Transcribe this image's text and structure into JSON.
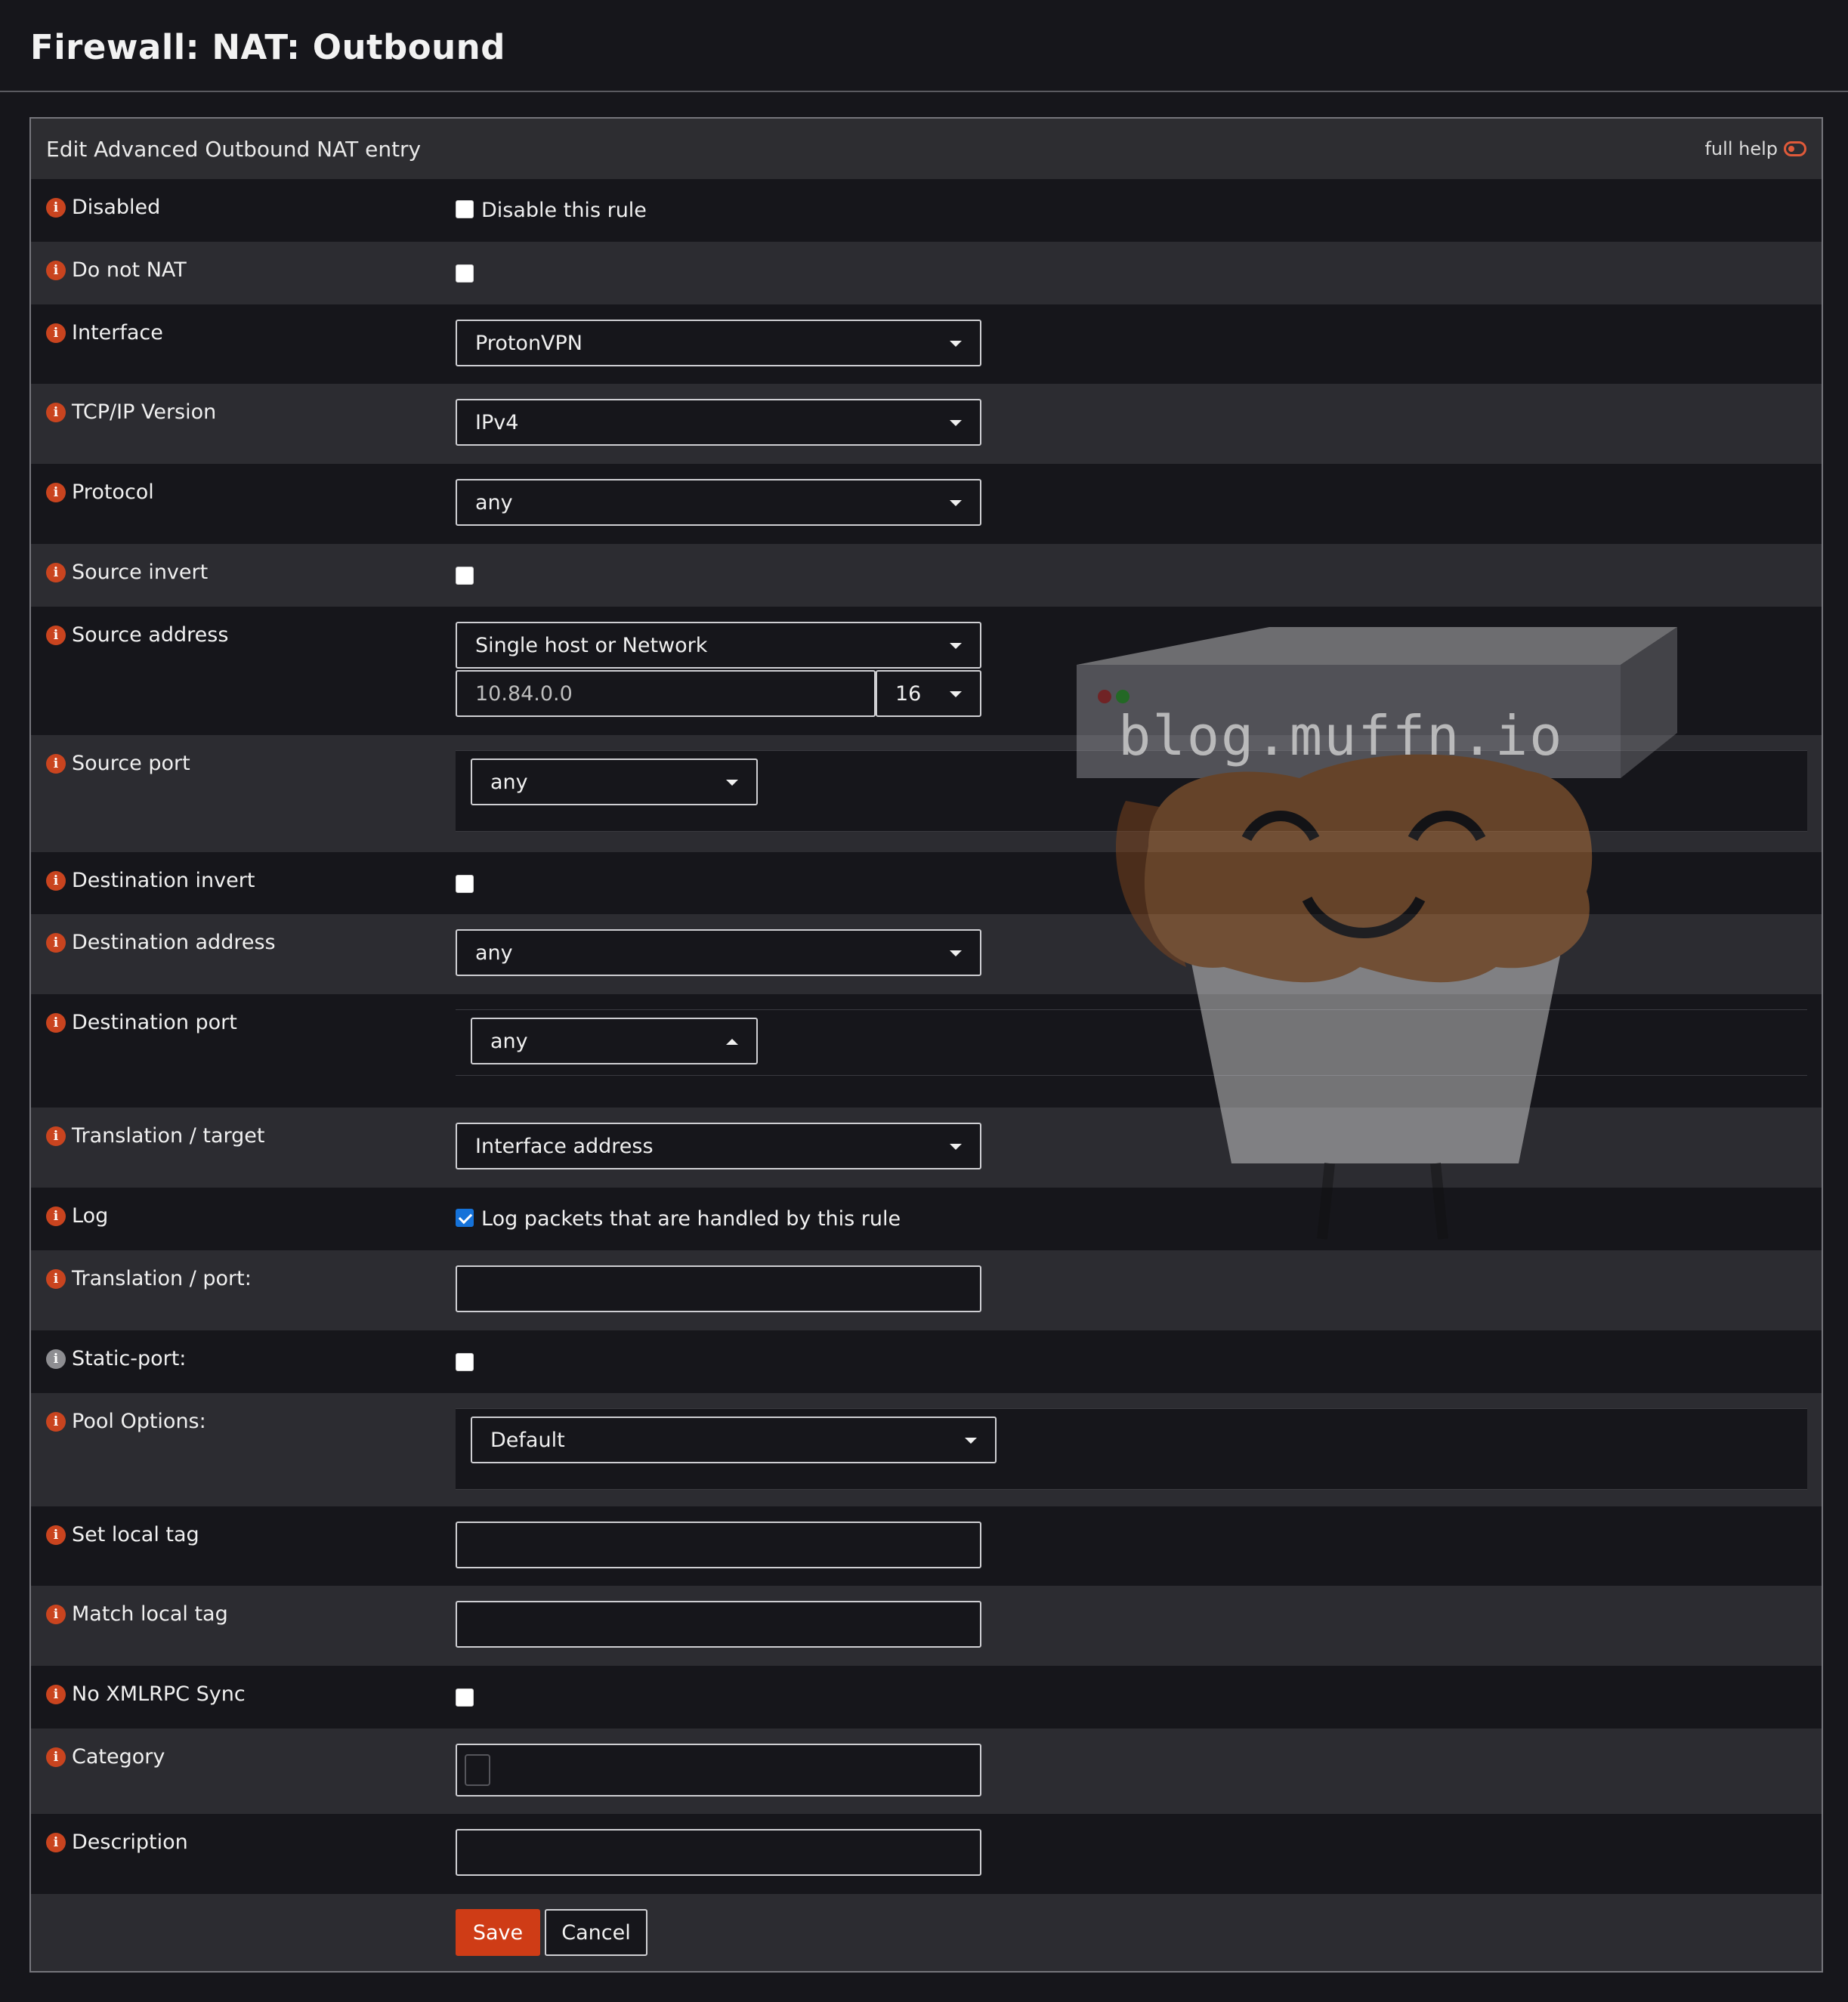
{
  "page": {
    "title": "Firewall: NAT: Outbound"
  },
  "panel": {
    "title": "Edit Advanced Outbound NAT entry",
    "full_help": "full help"
  },
  "fields": {
    "disabled": {
      "label": "Disabled",
      "checkbox_label": "Disable this rule",
      "checked": false
    },
    "do_not_nat": {
      "label": "Do not NAT",
      "checked": false
    },
    "interface": {
      "label": "Interface",
      "value": "ProtonVPN"
    },
    "tcpip_version": {
      "label": "TCP/IP Version",
      "value": "IPv4"
    },
    "protocol": {
      "label": "Protocol",
      "value": "any"
    },
    "source_invert": {
      "label": "Source invert",
      "checked": false
    },
    "source_address": {
      "label": "Source address",
      "type_value": "Single host or Network",
      "address": "10.84.0.0",
      "mask": "16"
    },
    "source_port": {
      "label": "Source port",
      "value": "any"
    },
    "destination_invert": {
      "label": "Destination invert",
      "checked": false
    },
    "destination_address": {
      "label": "Destination address",
      "value": "any"
    },
    "destination_port": {
      "label": "Destination port",
      "value": "any"
    },
    "translation_target": {
      "label": "Translation / target",
      "value": "Interface address"
    },
    "log": {
      "label": "Log",
      "checkbox_label": "Log packets that are handled by this rule",
      "checked": true
    },
    "translation_port": {
      "label": "Translation / port:",
      "value": ""
    },
    "static_port": {
      "label": "Static-port:",
      "checked": false
    },
    "pool_options": {
      "label": "Pool Options:",
      "value": "Default"
    },
    "set_local_tag": {
      "label": "Set local tag",
      "value": ""
    },
    "match_local_tag": {
      "label": "Match local tag",
      "value": ""
    },
    "no_xmlrpc_sync": {
      "label": "No XMLRPC Sync",
      "checked": false
    },
    "category": {
      "label": "Category",
      "value": ""
    },
    "description": {
      "label": "Description",
      "value": ""
    }
  },
  "actions": {
    "save": "Save",
    "cancel": "Cancel"
  },
  "watermark": {
    "text": "blog.muffn.io"
  },
  "colors": {
    "accent": "#cf3c16",
    "checkbox_checked": "#1572d9"
  }
}
